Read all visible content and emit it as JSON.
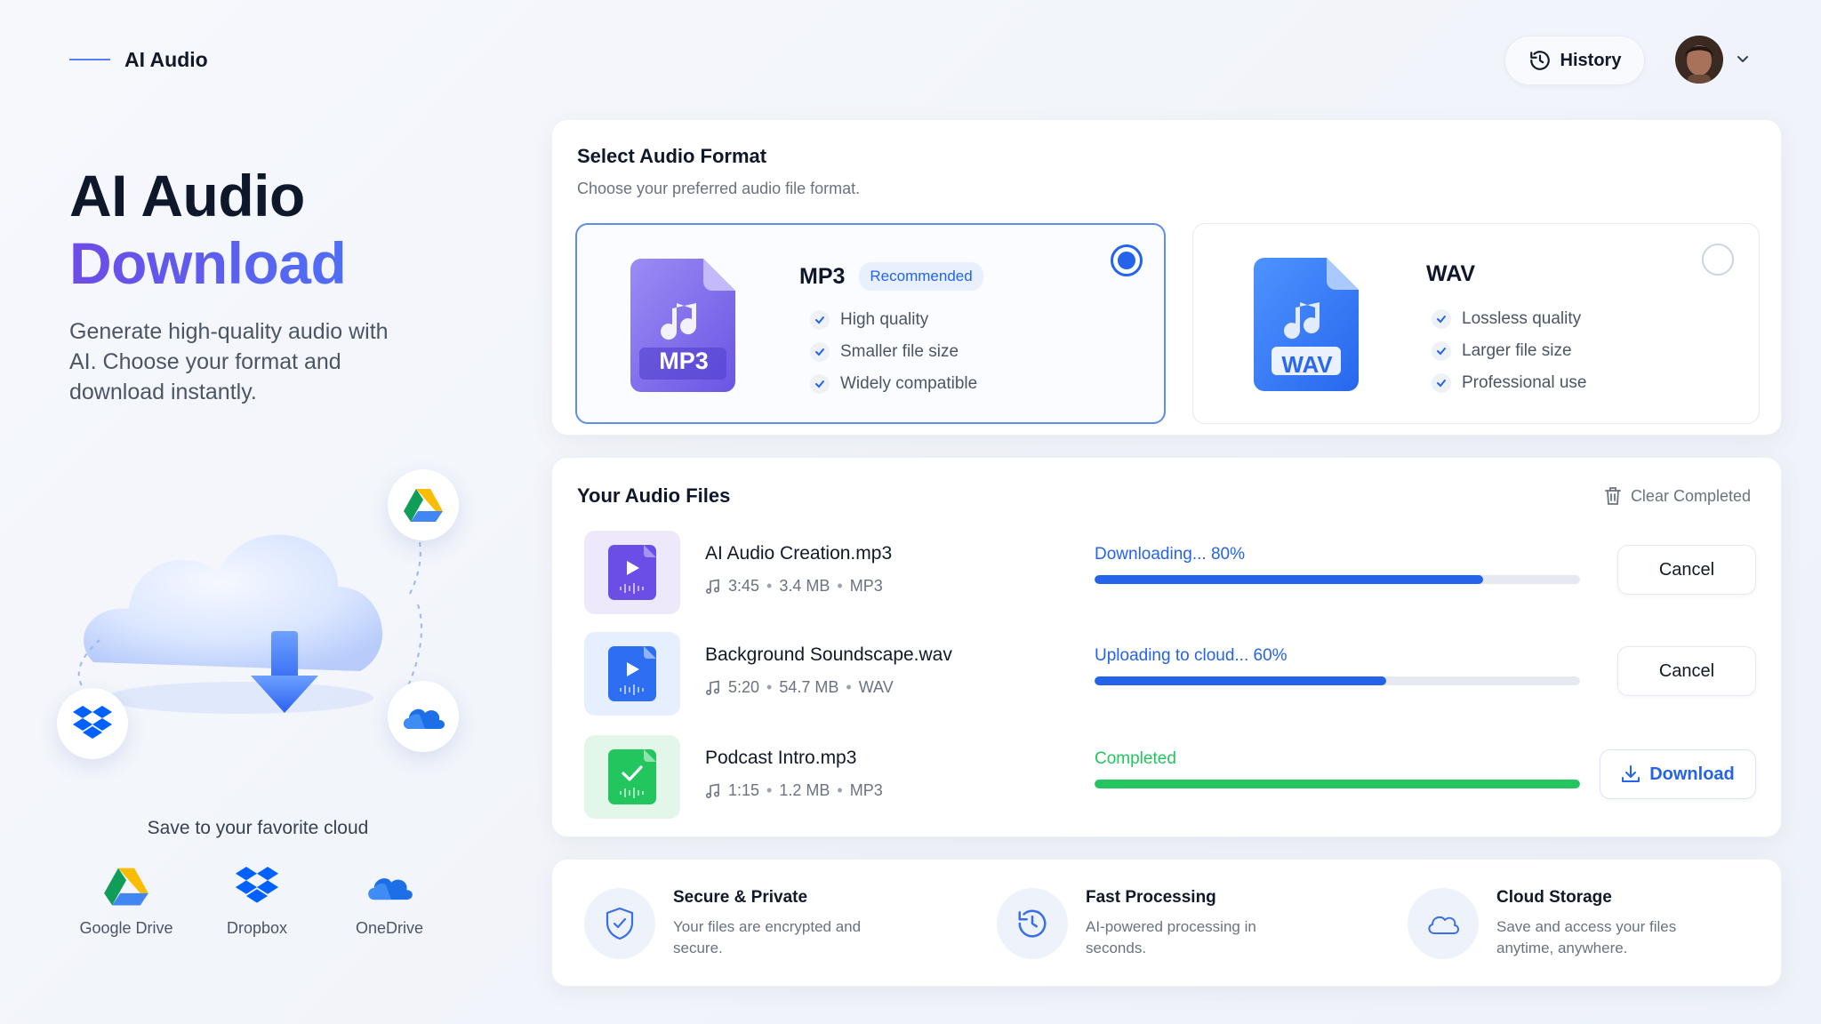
{
  "app": {
    "name": "AI Audio"
  },
  "header": {
    "history_label": "History"
  },
  "hero": {
    "title_line1": "AI Audio",
    "title_line2": "Download",
    "subtitle": "Generate high-quality audio with AI. Choose your format and download instantly."
  },
  "clouds": {
    "title": "Save to your favorite cloud",
    "items": [
      {
        "name": "Google Drive",
        "icon": "google-drive-icon"
      },
      {
        "name": "Dropbox",
        "icon": "dropbox-icon"
      },
      {
        "name": "OneDrive",
        "icon": "onedrive-icon"
      }
    ]
  },
  "format": {
    "title": "Select Audio Format",
    "subtitle": "Choose your preferred audio file format.",
    "options": [
      {
        "name": "MP3",
        "badge": "Recommended",
        "file_label": "MP3",
        "selected": true,
        "features": [
          "High quality",
          "Smaller file size",
          "Widely compatible"
        ]
      },
      {
        "name": "WAV",
        "badge": "",
        "file_label": "WAV",
        "selected": false,
        "features": [
          "Lossless quality",
          "Larger file size",
          "Professional use"
        ]
      }
    ]
  },
  "files": {
    "title": "Your Audio Files",
    "clear_label": "Clear Completed",
    "items": [
      {
        "name": "AI Audio Creation.mp3",
        "duration": "3:45",
        "size": "3.4 MB",
        "type": "MP3",
        "status": "Downloading... 80%",
        "progress": 0.8,
        "action": "Cancel"
      },
      {
        "name": "Background Soundscape.wav",
        "duration": "5:20",
        "size": "54.7 MB",
        "type": "WAV",
        "status": "Uploading to cloud... 60%",
        "progress": 0.6,
        "action": "Cancel"
      },
      {
        "name": "Podcast Intro.mp3",
        "duration": "1:15",
        "size": "1.2 MB",
        "type": "MP3",
        "status": "Completed",
        "progress": 1.0,
        "action": "Download"
      }
    ]
  },
  "features": [
    {
      "title": "Secure & Private",
      "desc": "Your files are encrypted and secure.",
      "icon": "shield-check-icon"
    },
    {
      "title": "Fast Processing",
      "desc": "AI-powered processing in seconds.",
      "icon": "clock-icon"
    },
    {
      "title": "Cloud Storage",
      "desc": "Save and access your files anytime, anywhere.",
      "icon": "cloud-icon"
    }
  ],
  "colors": {
    "accent": "#2563eb",
    "brand_purple": "#6d4ce6",
    "success": "#22c55e",
    "progress_blue": "#2563eb"
  }
}
